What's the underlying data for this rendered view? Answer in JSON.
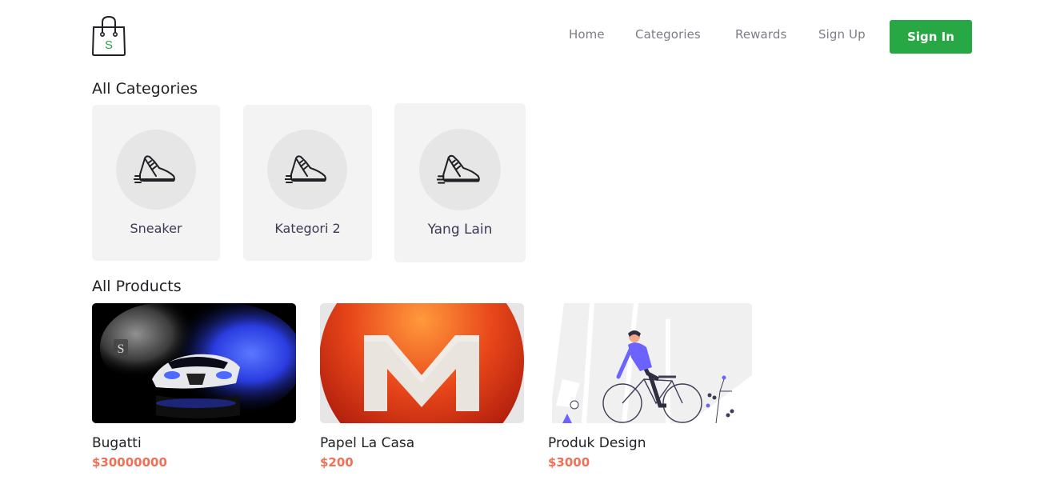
{
  "header": {
    "logo_icon": "shopping-bag-icon",
    "logo_letter": "S",
    "nav": [
      {
        "label": "Home"
      },
      {
        "label": "Categories"
      },
      {
        "label": "Rewards"
      },
      {
        "label": "Sign Up"
      }
    ],
    "signin_label": "Sign In"
  },
  "categories": {
    "title": "All Categories",
    "items": [
      {
        "label": "Sneaker",
        "icon": "sneaker-icon"
      },
      {
        "label": "Kategori 2",
        "icon": "sneaker-icon"
      },
      {
        "label": "Yang Lain",
        "icon": "sneaker-icon"
      }
    ]
  },
  "products": {
    "title": "All Products",
    "items": [
      {
        "name": "Bugatti",
        "price": "$30000000",
        "image": "bugatti-car-image"
      },
      {
        "name": "Papel La Casa",
        "price": "$200",
        "image": "mega-logo-image"
      },
      {
        "name": "Produk Design",
        "price": "$3000",
        "image": "cyclist-illustration-image"
      }
    ]
  },
  "colors": {
    "primary": "#28a745",
    "price": "#f07055",
    "card_bg": "#f3f3f3"
  }
}
